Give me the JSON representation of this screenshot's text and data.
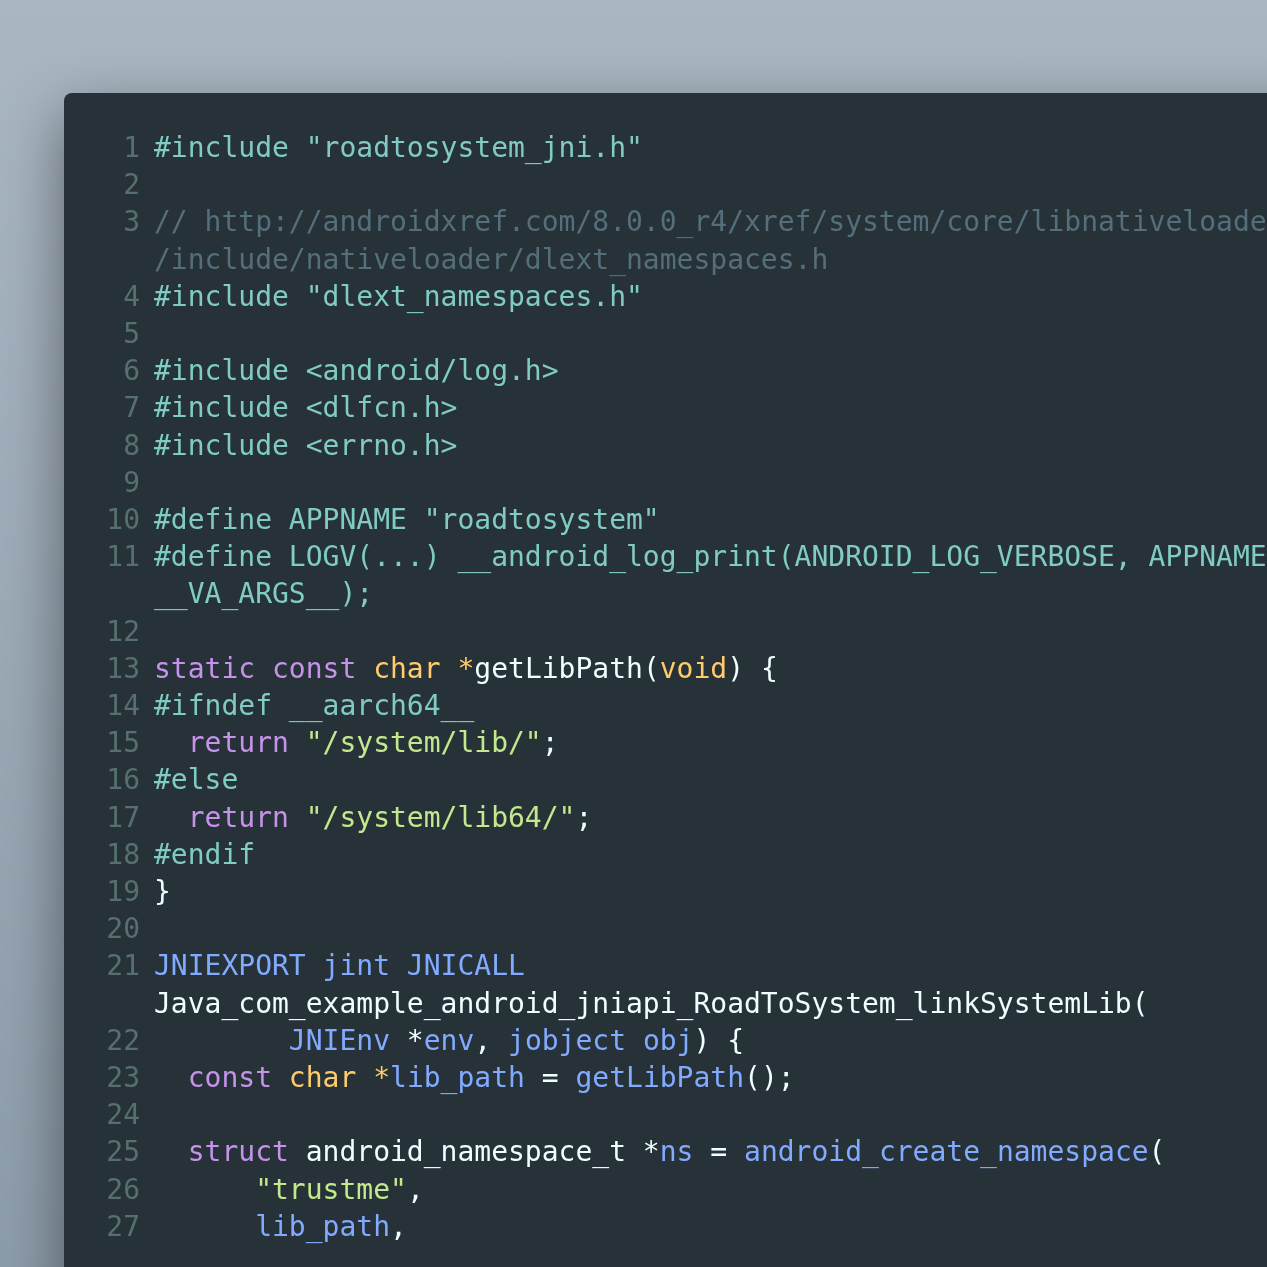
{
  "editor": {
    "lines": [
      {
        "number": "1",
        "rows": [
          [
            {
              "kind": "preproc",
              "text": "#include \"roadtosystem_jni.h\""
            }
          ]
        ]
      },
      {
        "number": "2"
      },
      {
        "number": "3",
        "rows": [
          [
            {
              "kind": "comment",
              "text": "// http://androidxref.com/8.0.0_r4/xref/system/core/libnativeloade"
            }
          ],
          [
            {
              "kind": "comment",
              "text": "/include/nativeloader/dlext_namespaces.h"
            }
          ]
        ]
      },
      {
        "number": "4",
        "rows": [
          [
            {
              "kind": "preproc",
              "text": "#include \"dlext_namespaces.h\""
            }
          ]
        ]
      },
      {
        "number": "5"
      },
      {
        "number": "6",
        "rows": [
          [
            {
              "kind": "preproc",
              "text": "#include <android/log.h>"
            }
          ]
        ]
      },
      {
        "number": "7",
        "rows": [
          [
            {
              "kind": "preproc",
              "text": "#include <dlfcn.h>"
            }
          ]
        ]
      },
      {
        "number": "8",
        "rows": [
          [
            {
              "kind": "preproc",
              "text": "#include <errno.h>"
            }
          ]
        ]
      },
      {
        "number": "9"
      },
      {
        "number": "10",
        "rows": [
          [
            {
              "kind": "preproc",
              "text": "#define APPNAME \"roadtosystem\""
            }
          ]
        ]
      },
      {
        "number": "11",
        "rows": [
          [
            {
              "kind": "preproc",
              "text": "#define LOGV(...) __android_log_print(ANDROID_LOG_VERBOSE, APPNAME"
            }
          ],
          [
            {
              "kind": "preproc",
              "text": "__VA_ARGS__);"
            }
          ]
        ]
      },
      {
        "number": "12"
      },
      {
        "number": "13",
        "rows": [
          [
            {
              "kind": "keyword",
              "text": "static const"
            },
            {
              "kind": "type",
              "text": " char *"
            },
            {
              "kind": "plain",
              "text": "getLibPath("
            },
            {
              "kind": "type",
              "text": "void"
            },
            {
              "kind": "plain",
              "text": ") {"
            }
          ]
        ]
      },
      {
        "number": "14",
        "rows": [
          [
            {
              "kind": "preproc",
              "text": "#ifndef __aarch64__"
            }
          ]
        ]
      },
      {
        "number": "15",
        "rows": [
          [
            {
              "kind": "keyword",
              "text": "  return"
            },
            {
              "kind": "string",
              "text": " \"/system/lib/\""
            },
            {
              "kind": "plain",
              "text": ";"
            }
          ]
        ]
      },
      {
        "number": "16",
        "rows": [
          [
            {
              "kind": "preproc",
              "text": "#else"
            }
          ]
        ]
      },
      {
        "number": "17",
        "rows": [
          [
            {
              "kind": "keyword",
              "text": "  return"
            },
            {
              "kind": "string",
              "text": " \"/system/lib64/\""
            },
            {
              "kind": "plain",
              "text": ";"
            }
          ]
        ]
      },
      {
        "number": "18",
        "rows": [
          [
            {
              "kind": "preproc",
              "text": "#endif"
            }
          ]
        ]
      },
      {
        "number": "19",
        "rows": [
          [
            {
              "kind": "plain",
              "text": "}"
            }
          ]
        ]
      },
      {
        "number": "20"
      },
      {
        "number": "21",
        "rows": [
          [
            {
              "kind": "function",
              "text": "JNIEXPORT jint JNICALL"
            }
          ],
          [
            {
              "kind": "plain",
              "text": "Java_com_example_android_jniapi_RoadToSystem_linkSystemLib("
            }
          ]
        ]
      },
      {
        "number": "22",
        "rows": [
          [
            {
              "kind": "function",
              "text": "        JNIEnv"
            },
            {
              "kind": "plain",
              "text": " *"
            },
            {
              "kind": "function",
              "text": "env"
            },
            {
              "kind": "plain",
              "text": ", "
            },
            {
              "kind": "function",
              "text": "jobject obj"
            },
            {
              "kind": "plain",
              "text": ") {"
            }
          ]
        ]
      },
      {
        "number": "23",
        "rows": [
          [
            {
              "kind": "keyword",
              "text": "  const"
            },
            {
              "kind": "type",
              "text": " char *"
            },
            {
              "kind": "function",
              "text": "lib_path"
            },
            {
              "kind": "plain",
              "text": " = "
            },
            {
              "kind": "function",
              "text": "getLibPath"
            },
            {
              "kind": "plain",
              "text": "();"
            }
          ]
        ]
      },
      {
        "number": "24"
      },
      {
        "number": "25",
        "rows": [
          [
            {
              "kind": "keyword",
              "text": "  struct"
            },
            {
              "kind": "plain",
              "text": " android_namespace_t *"
            },
            {
              "kind": "function",
              "text": "ns"
            },
            {
              "kind": "plain",
              "text": " = "
            },
            {
              "kind": "function",
              "text": "android_create_namespace"
            },
            {
              "kind": "plain",
              "text": "("
            }
          ]
        ]
      },
      {
        "number": "26",
        "rows": [
          [
            {
              "kind": "string",
              "text": "      \"trustme\""
            },
            {
              "kind": "plain",
              "text": ","
            }
          ]
        ]
      },
      {
        "number": "27",
        "rows": [
          [
            {
              "kind": "function",
              "text": "      lib_path"
            },
            {
              "kind": "plain",
              "text": ","
            }
          ]
        ]
      }
    ]
  }
}
